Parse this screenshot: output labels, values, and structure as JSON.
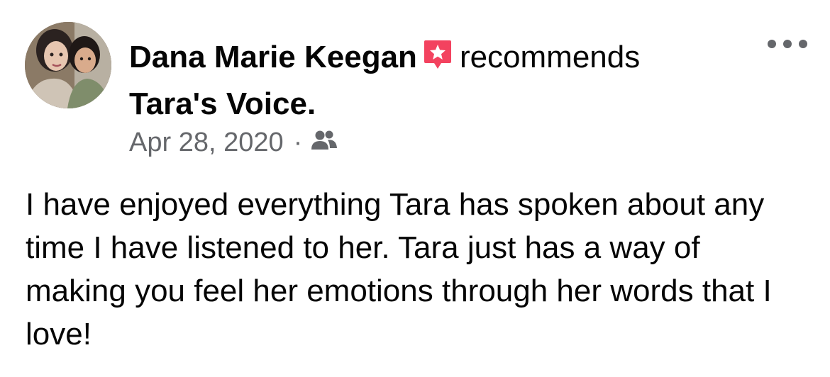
{
  "post": {
    "author": "Dana Marie Keegan",
    "action": "recommends",
    "page_name": "Tara's Voice",
    "page_name_suffix": ".",
    "date": "Apr 28, 2020",
    "separator": "·",
    "audience_icon": "friends-icon",
    "recommend_icon": "recommend-star-icon",
    "more_icon": "more-options-icon",
    "body": "I have enjoyed everything Tara has spoken about any time I have listened to her. Tara just has a way of making you feel her emotions through her words that I love!"
  },
  "colors": {
    "text": "#050505",
    "secondary_text": "#65676b",
    "recommend_badge": "#f3425f"
  }
}
